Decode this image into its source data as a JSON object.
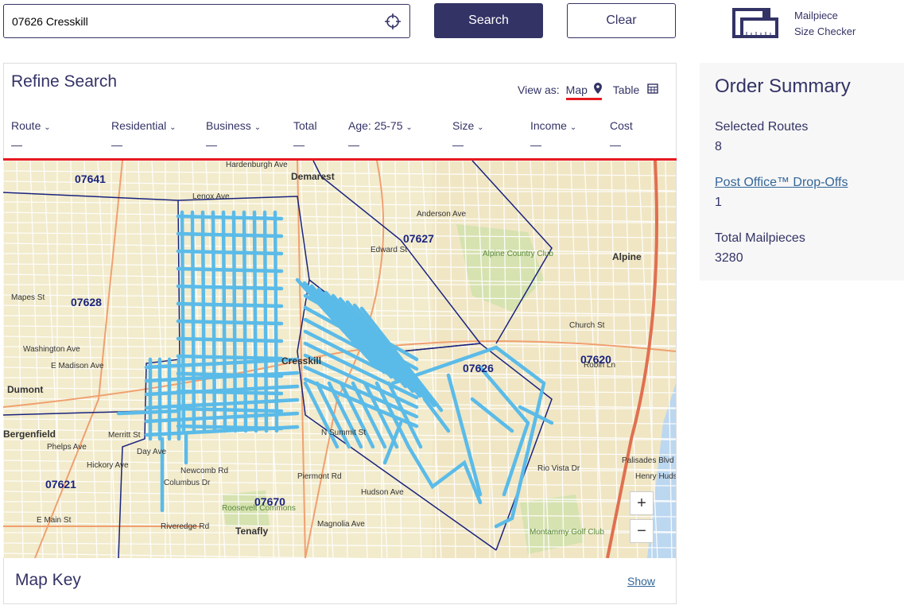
{
  "search": {
    "value": "07626 Cresskill",
    "search_label": "Search",
    "clear_label": "Clear"
  },
  "checker": {
    "line1": "Mailpiece",
    "line2": "Size Checker"
  },
  "refine": {
    "title": "Refine Search",
    "view_as": "View as:",
    "map": "Map",
    "table": "Table",
    "columns": [
      {
        "label": "Route",
        "chev": true
      },
      {
        "label": "Residential",
        "chev": true
      },
      {
        "label": "Business",
        "chev": true
      },
      {
        "label": "Total",
        "chev": false
      },
      {
        "label": "Age: 25-75",
        "chev": true
      },
      {
        "label": "Size",
        "chev": true
      },
      {
        "label": "Income",
        "chev": true
      },
      {
        "label": "Cost",
        "chev": false
      }
    ],
    "empty": "—"
  },
  "map": {
    "labels": [
      "07641",
      "Demarest",
      "Lenox Ave",
      "07627",
      "Alpine Country Club",
      "Alpine",
      "07628",
      "Mapes St",
      "Washington Ave",
      "E Madison Ave",
      "Dumont",
      "Cresskill",
      "07626",
      "07620",
      "Bergenfield",
      "Phelps Ave",
      "Hickory Ave",
      "07621",
      "Columbus Dr",
      "Newcomb Rd",
      "07670",
      "Roosevelt Commons",
      "Tenafly",
      "E Main St",
      "Riveredge Rd",
      "N Summit St",
      "Hudson Ave",
      "Piermont Rd",
      "Magnolia Ave",
      "Edward St",
      "Church St",
      "Robin Ln",
      "Rio Vista Dr",
      "Palisades Blvd",
      "Henry Hudson Dr",
      "Montammy Golf Club",
      "Anderson Ave",
      "Hardenburgh Ave",
      "Merritt St",
      "Day Ave"
    ],
    "zoom_in": "+",
    "zoom_out": "−",
    "route_color": "#5bbbe8",
    "boundary_color": "#1a237e"
  },
  "map_key": {
    "title": "Map Key",
    "show": "Show"
  },
  "summary": {
    "title": "Order Summary",
    "routes_label": "Selected Routes",
    "routes": "8",
    "po_label": "Post Office™ Drop-Offs",
    "po": "1",
    "mail_label": "Total Mailpieces",
    "mail": "3280"
  }
}
